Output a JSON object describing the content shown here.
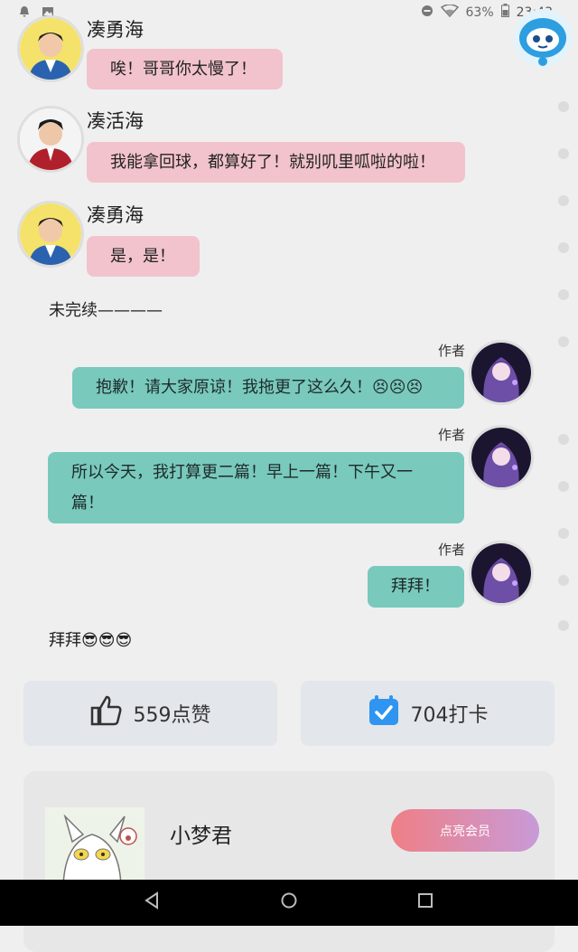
{
  "status": {
    "battery": "63%",
    "time": "23:43"
  },
  "chat": {
    "msg1": {
      "name": "凑勇海",
      "text": "唉！哥哥你太慢了！"
    },
    "msg2": {
      "name": "凑活海",
      "text": "我能拿回球，都算好了！就别叽里呱啦的啦！"
    },
    "msg3": {
      "name": "凑勇海",
      "text": "是，是！"
    },
    "narration1": "未完续————",
    "author_msgs": [
      {
        "label": "作者",
        "text": "抱歉！请大家原谅！我拖更了这么久！😣😣😣"
      },
      {
        "label": "作者",
        "text": "所以今天，我打算更二篇！早上一篇！下午又一篇！"
      },
      {
        "label": "作者",
        "text": "拜拜！"
      }
    ],
    "narration2": "拜拜😎😎😎"
  },
  "actions": {
    "like": "559点赞",
    "checkin": "704打卡"
  },
  "member": {
    "name": "小梦君",
    "button": "点亮会员"
  },
  "colors": {
    "pink_bubble": "#f2c3cc",
    "teal_bubble": "#79c9bd",
    "background": "#efeff0"
  },
  "icons": [
    "notification-icon",
    "image-icon",
    "dnd-icon",
    "wifi-icon",
    "battery-icon",
    "robot-assistant-icon",
    "thumbs-up-icon",
    "calendar-check-icon",
    "back-icon",
    "home-icon",
    "recents-icon"
  ]
}
